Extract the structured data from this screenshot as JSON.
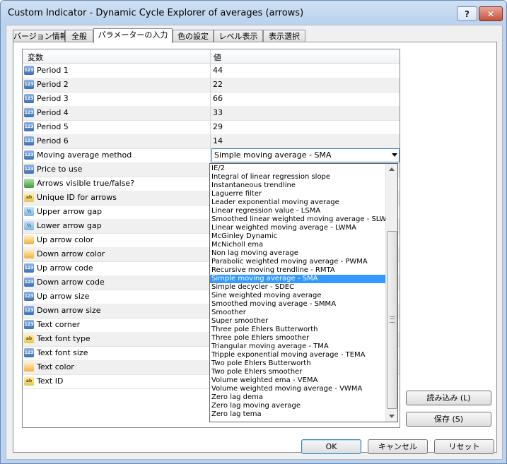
{
  "window": {
    "title": "Custom Indicator - Dynamic Cycle Explorer of averages (arrows)",
    "help_label": "?",
    "close_label": "✕"
  },
  "tabs": [
    {
      "label": "バージョン情報"
    },
    {
      "label": "全般"
    },
    {
      "label": "パラメーターの入力"
    },
    {
      "label": "色の設定"
    },
    {
      "label": "レベル表示"
    },
    {
      "label": "表示選択"
    }
  ],
  "grid": {
    "header": {
      "variable": "変数",
      "value": "値"
    },
    "rows": [
      {
        "label": "Period 1",
        "value": "44",
        "icon": "number-icon",
        "icon_text": "123"
      },
      {
        "label": "Period 2",
        "value": "22",
        "icon": "number-icon",
        "icon_text": "123"
      },
      {
        "label": "Period 3",
        "value": "66",
        "icon": "number-icon",
        "icon_text": "123"
      },
      {
        "label": "Period 4",
        "value": "33",
        "icon": "number-icon",
        "icon_text": "123"
      },
      {
        "label": "Period 5",
        "value": "29",
        "icon": "number-icon",
        "icon_text": "123"
      },
      {
        "label": "Period 6",
        "value": "14",
        "icon": "number-icon",
        "icon_text": "123"
      },
      {
        "label": "Moving average method",
        "value": "Simple moving average - SMA",
        "icon": "number-icon",
        "icon_text": "123"
      },
      {
        "label": "Price to use",
        "value": "",
        "icon": "number-icon",
        "icon_text": "123"
      },
      {
        "label": "Arrows visible true/false?",
        "value": "",
        "icon": "boolean-icon",
        "icon_text": ""
      },
      {
        "label": "Unique ID for arrows",
        "value": "",
        "icon": "string-icon",
        "icon_text": "ab"
      },
      {
        "label": "Upper arrow gap",
        "value": "",
        "icon": "fraction-icon",
        "icon_text": "½"
      },
      {
        "label": "Lower arrow gap",
        "value": "",
        "icon": "fraction-icon",
        "icon_text": "½"
      },
      {
        "label": "Up arrow color",
        "value": "",
        "icon": "color-icon",
        "icon_text": ""
      },
      {
        "label": "Down arrow color",
        "value": "",
        "icon": "color-icon",
        "icon_text": ""
      },
      {
        "label": "Up arrow code",
        "value": "",
        "icon": "number-icon",
        "icon_text": "123"
      },
      {
        "label": "Down arrow code",
        "value": "",
        "icon": "number-icon",
        "icon_text": "123"
      },
      {
        "label": "Up arrow size",
        "value": "",
        "icon": "number-icon",
        "icon_text": "123"
      },
      {
        "label": "Down arrow size",
        "value": "",
        "icon": "number-icon",
        "icon_text": "123"
      },
      {
        "label": "Text corner",
        "value": "",
        "icon": "number-icon",
        "icon_text": "123"
      },
      {
        "label": "Text font type",
        "value": "",
        "icon": "string-icon",
        "icon_text": "ab"
      },
      {
        "label": "Text font size",
        "value": "",
        "icon": "number-icon",
        "icon_text": "123"
      },
      {
        "label": "Text color",
        "value": "",
        "icon": "color-icon",
        "icon_text": ""
      },
      {
        "label": "Text ID",
        "value": "",
        "icon": "string-icon",
        "icon_text": "ab"
      }
    ]
  },
  "dropdown": {
    "selected": "Simple moving average - SMA",
    "options": [
      "IE/2",
      "Integral of linear regression slope",
      "Instantaneous trendline",
      "Laguerre filter",
      "Leader exponential moving average",
      "Linear regression value - LSMA",
      "Smoothed linear weighted moving average - SLWMA",
      "Linear weighted moving average - LWMA",
      "McGinley Dynamic",
      "McNicholl ema",
      "Non lag moving average",
      "Parabolic weighted moving average - PWMA",
      "Recursive moving trendline - RMTA",
      "Simple moving average - SMA",
      "Simple decycler - SDEC",
      "Sine weighted moving average",
      "Smoothed moving average - SMMA",
      "Smoother",
      "Super smoother",
      "Three pole Ehlers Butterworth",
      "Three pole Ehlers smoother",
      "Triangular moving average - TMA",
      "Tripple exponential moving average - TEMA",
      "Two pole Ehlers Butterworth",
      "Two pole Ehlers smoother",
      "Volume weighted ema - VEMA",
      "Volume weighted moving average - VWMA",
      "Zero lag dema",
      "Zero lag moving average",
      "Zero lag tema"
    ]
  },
  "side_buttons": {
    "load": "読み込み (L)",
    "save": "保存 (S)"
  },
  "footer": {
    "ok": "OK",
    "cancel": "キャンセル",
    "reset": "リセット"
  },
  "colors": {
    "selection": "#3399ff",
    "accent": "#3c7fb1",
    "frame": "#bcd3ee"
  }
}
